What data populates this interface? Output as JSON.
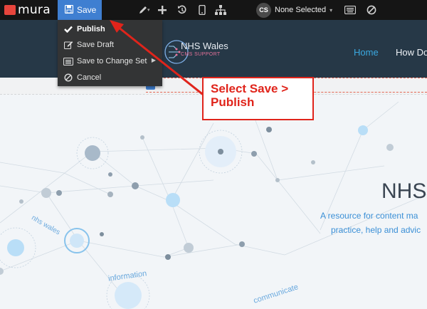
{
  "toolbar": {
    "logo_text": "mura",
    "save_label": "Save",
    "tools": [
      "pencil-icon",
      "plus-icon",
      "history-icon",
      "mobile-icon",
      "sitemap-icon"
    ],
    "approval": {
      "initials": "CS",
      "label": "None Selected"
    },
    "right_tools": [
      "keyboard-icon",
      "ban-icon"
    ],
    "colors": {
      "bar": "#151515",
      "save": "#3f7fd1"
    }
  },
  "save_menu": {
    "items": [
      {
        "label": "Publish",
        "icon": "check-icon"
      },
      {
        "label": "Save Draft",
        "icon": "edit-icon"
      },
      {
        "label": "Save to Change Set",
        "icon": "list-icon"
      },
      {
        "label": "Cancel",
        "icon": "ban-icon"
      }
    ]
  },
  "site": {
    "logo_title": "NHS Wales",
    "logo_subtitle": "CMS SUPPORT",
    "nav": {
      "home": "Home",
      "how_do": "How Do"
    }
  },
  "hero": {
    "title": "NHS",
    "line1": "A resource for content ma",
    "line2": "practice, help and advic",
    "tags": [
      "nhs wales",
      "information",
      "communicate"
    ]
  },
  "callout": {
    "text": "Select Save > Publish",
    "color": "#e0241b"
  }
}
